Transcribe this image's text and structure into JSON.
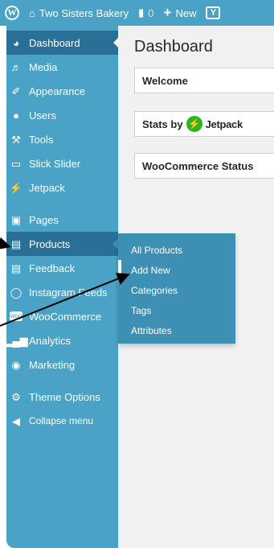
{
  "adminbar": {
    "site_name": "Two Sisters Bakery",
    "comments_count": "0",
    "new_label": "New",
    "wp_logo_icon": "wordpress-icon",
    "home_icon": "home-icon",
    "comment_icon": "comment-icon",
    "plus_icon": "plus-icon",
    "yoast_icon": "yoast-icon"
  },
  "sidebar": {
    "items": [
      {
        "label": "Dashboard",
        "icon": "dashboard-icon"
      },
      {
        "label": "Media",
        "icon": "media-icon"
      },
      {
        "label": "Appearance",
        "icon": "appearance-icon"
      },
      {
        "label": "Users",
        "icon": "users-icon"
      },
      {
        "label": "Tools",
        "icon": "tools-icon"
      },
      {
        "label": "Slick Slider",
        "icon": "slider-icon"
      },
      {
        "label": "Jetpack",
        "icon": "jetpack-icon"
      },
      {
        "label": "Pages",
        "icon": "pages-icon"
      },
      {
        "label": "Products",
        "icon": "products-icon"
      },
      {
        "label": "Feedback",
        "icon": "feedback-icon"
      },
      {
        "label": "Instagram Feeds",
        "icon": "instagram-icon"
      },
      {
        "label": "WooCommerce",
        "icon": "woocommerce-icon"
      },
      {
        "label": "Analytics",
        "icon": "analytics-icon"
      },
      {
        "label": "Marketing",
        "icon": "marketing-icon"
      },
      {
        "label": "Theme Options",
        "icon": "gear-icon"
      },
      {
        "label": "Collapse menu",
        "icon": "collapse-icon"
      }
    ]
  },
  "flyout": {
    "items": [
      "All Products",
      "Add New",
      "Categories",
      "Tags",
      "Attributes"
    ]
  },
  "main": {
    "title": "Dashboard",
    "widgets": {
      "welcome": "Welcome",
      "stats_prefix": "Stats by",
      "stats_brand": "Jetpack",
      "woo_status": "WooCommerce Status"
    }
  },
  "colors": {
    "menu_bg": "#4aa3c6",
    "menu_active": "#2a6f95",
    "flyout_bg": "#3d90b3",
    "content_bg": "#f1f1f1",
    "jetpack_green": "#2fb41f"
  }
}
